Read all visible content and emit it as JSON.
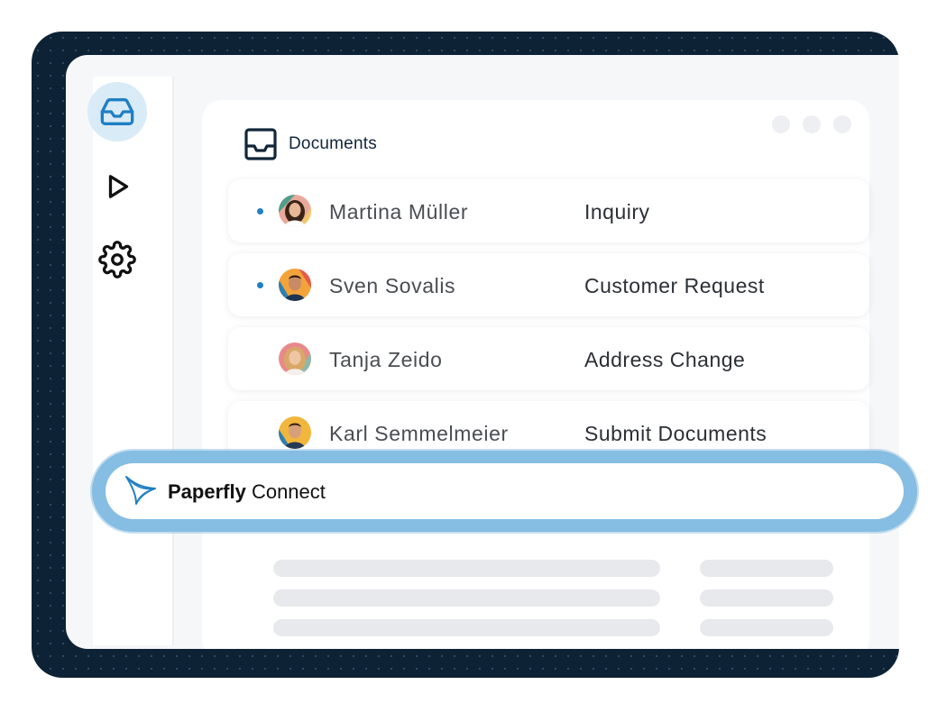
{
  "colors": {
    "backdrop": "#0d2235",
    "accent": "#1f7fc4",
    "active_nav_bg": "#d9ebf7",
    "halo": "#86bde2"
  },
  "sidebar": {
    "items": [
      {
        "icon": "inbox-icon",
        "active": true
      },
      {
        "icon": "play-icon",
        "active": false
      },
      {
        "icon": "gear-icon",
        "active": false
      }
    ]
  },
  "panel": {
    "title": "Documents",
    "title_icon": "inbox-icon"
  },
  "documents": [
    {
      "name": "Martina Müller",
      "subject": "Inquiry",
      "unread": true
    },
    {
      "name": "Sven Sovalis",
      "subject": "Customer Request",
      "unread": true
    },
    {
      "name": "Tanja Zeido",
      "subject": "Address Change",
      "unread": false
    },
    {
      "name": "Karl Semmelmeier",
      "subject": "Submit Documents",
      "unread": false
    }
  ],
  "connect": {
    "brand": "Paperfly",
    "product": "Connect",
    "logo_icon": "paper-plane-icon"
  }
}
